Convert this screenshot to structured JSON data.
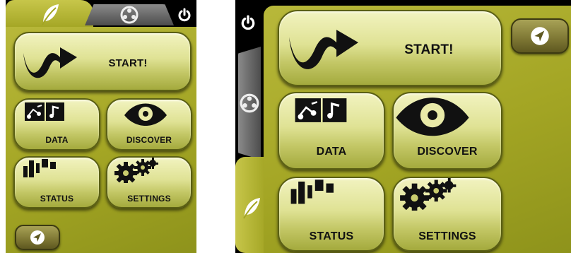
{
  "left_screen": {
    "tabs": {
      "leaf": "leaf-icon",
      "film": "film-reel-icon",
      "power": "power-icon"
    },
    "start_label": "START!",
    "data_label": "DATA",
    "discover_label": "DISCOVER",
    "status_label": "STATUS",
    "settings_label": "SETTINGS",
    "nav_icon": "navigation-arrow-icon"
  },
  "right_screen": {
    "tabs": {
      "power": "power-icon",
      "film": "film-reel-icon",
      "leaf": "leaf-icon"
    },
    "start_label": "START!",
    "data_label": "DATA",
    "discover_label": "DISCOVER",
    "status_label": "STATUS",
    "settings_label": "SETTINGS",
    "nav_icon": "navigation-arrow-icon"
  },
  "colors": {
    "panel": "#a3a524",
    "button_top": "#f2f3c0",
    "button_bottom": "#a4aa3d",
    "tab_dark": "#1c1c1c"
  }
}
